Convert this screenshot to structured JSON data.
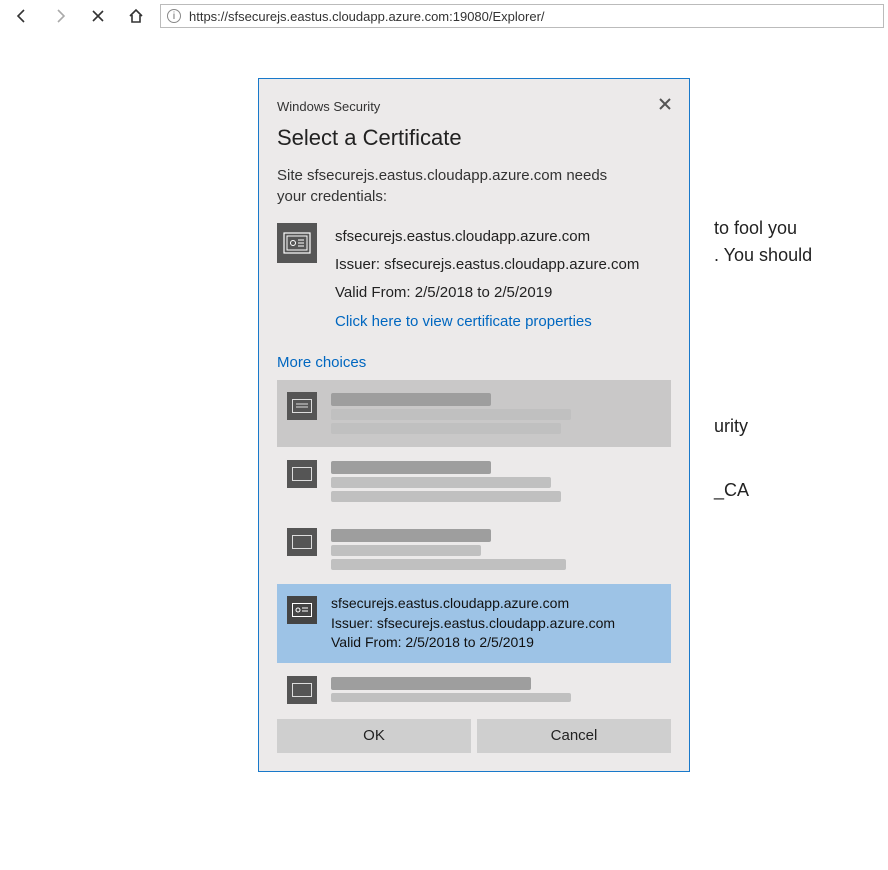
{
  "toolbar": {
    "url": "https://sfsecurejs.eastus.cloudapp.azure.com:19080/Explorer/"
  },
  "bg": {
    "line_a": "to fool you",
    "line_b": ". You should",
    "line_c": "urity",
    "line_d": "_CA"
  },
  "dialog": {
    "brand": "Windows Security",
    "title": "Select a Certificate",
    "message": "Site sfsecurejs.eastus.cloudapp.azure.com needs your credentials:",
    "cert": {
      "subject": "sfsecurejs.eastus.cloudapp.azure.com",
      "issuer": "Issuer: sfsecurejs.eastus.cloudapp.azure.com",
      "valid": "Valid From: 2/5/2018 to 2/5/2019",
      "link": "Click here to view certificate properties"
    },
    "more": "More choices",
    "selected": {
      "subject": "sfsecurejs.eastus.cloudapp.azure.com",
      "issuer": "Issuer: sfsecurejs.eastus.cloudapp.azure.com",
      "valid": "Valid From: 2/5/2018 to 2/5/2019"
    },
    "ok": "OK",
    "cancel": "Cancel"
  }
}
